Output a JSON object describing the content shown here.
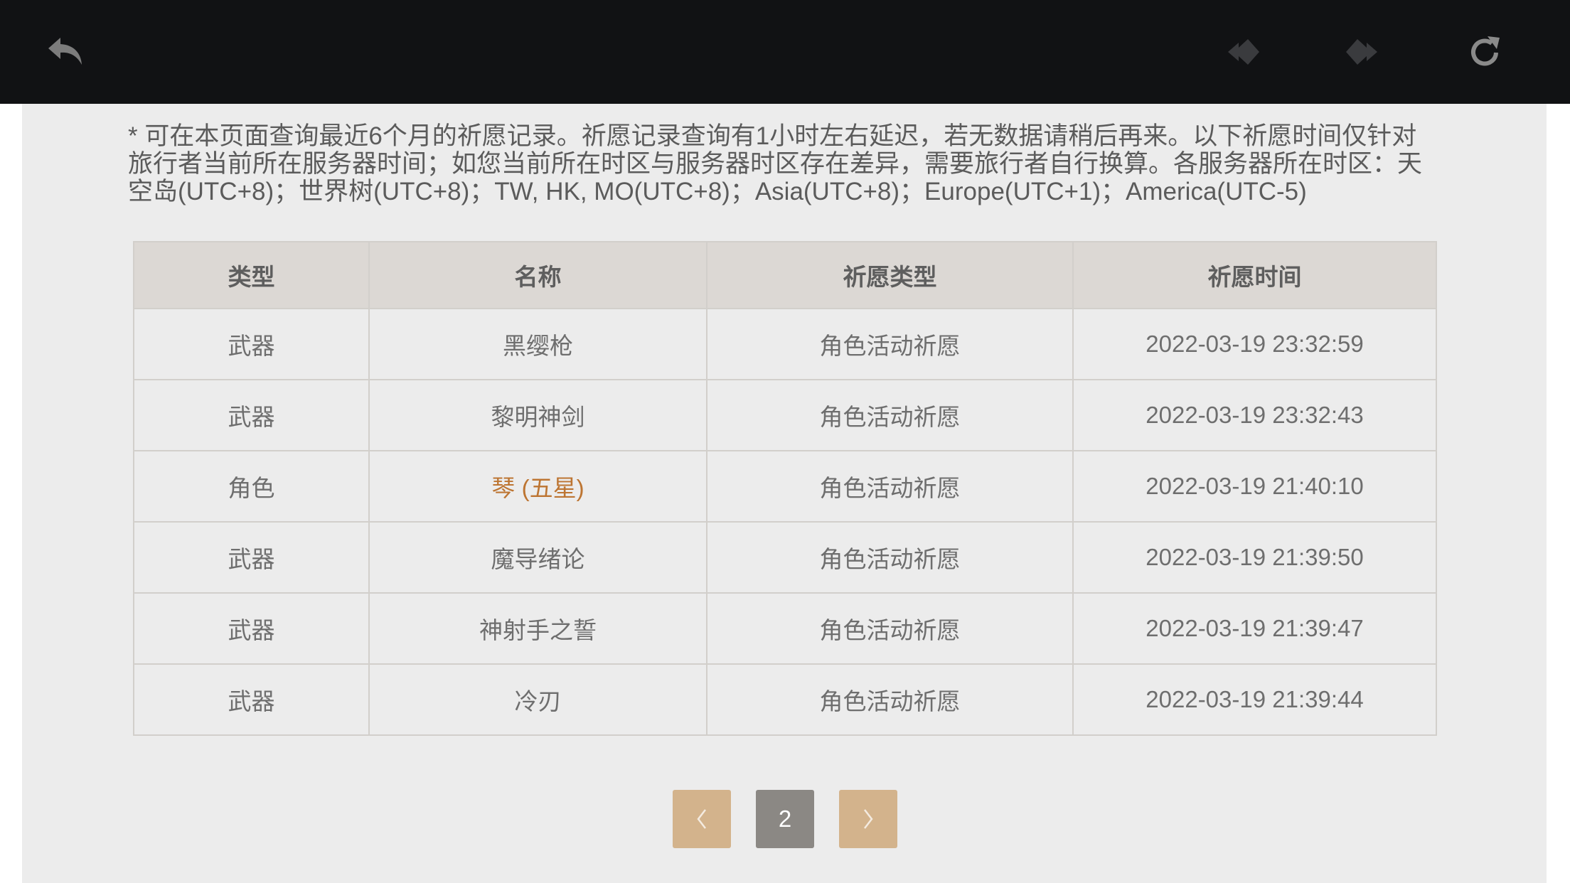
{
  "toolbar": {
    "back_icon": "back-arrow-icon",
    "prev_icon": "prev-diamond-icon",
    "next_icon": "next-diamond-icon",
    "refresh_icon": "refresh-icon"
  },
  "notice": "* 可在本页面查询最近6个月的祈愿记录。祈愿记录查询有1小时左右延迟，若无数据请稍后再来。以下祈愿时间仅针对旅行者当前所在服务器时间；如您当前所在时区与服务器时区存在差异，需要旅行者自行换算。各服务器所在时区：天空岛(UTC+8)；世界树(UTC+8)；TW, HK, MO(UTC+8)；Asia(UTC+8)；Europe(UTC+1)；America(UTC-5)",
  "table": {
    "headers": [
      "类型",
      "名称",
      "祈愿类型",
      "祈愿时间"
    ],
    "rows": [
      {
        "type": "武器",
        "name": "黑缨枪",
        "wish_type": "角色活动祈愿",
        "time": "2022-03-19 23:32:59",
        "highlight": false
      },
      {
        "type": "武器",
        "name": "黎明神剑",
        "wish_type": "角色活动祈愿",
        "time": "2022-03-19 23:32:43",
        "highlight": false
      },
      {
        "type": "角色",
        "name": "琴 (五星)",
        "wish_type": "角色活动祈愿",
        "time": "2022-03-19 21:40:10",
        "highlight": true
      },
      {
        "type": "武器",
        "name": "魔导绪论",
        "wish_type": "角色活动祈愿",
        "time": "2022-03-19 21:39:50",
        "highlight": false
      },
      {
        "type": "武器",
        "name": "神射手之誓",
        "wish_type": "角色活动祈愿",
        "time": "2022-03-19 21:39:47",
        "highlight": false
      },
      {
        "type": "武器",
        "name": "冷刃",
        "wish_type": "角色活动祈愿",
        "time": "2022-03-19 21:39:44",
        "highlight": false
      }
    ]
  },
  "pagination": {
    "prev_icon": "chevron-left-icon",
    "current_page": "2",
    "next_icon": "chevron-right-icon"
  },
  "colors": {
    "toolbar_bg": "#111214",
    "panel_bg": "#ececec",
    "header_bg": "#dcd8d4",
    "five_star": "#bd7532",
    "pager_button": "#d3b38c",
    "pager_current": "#8b8884"
  }
}
